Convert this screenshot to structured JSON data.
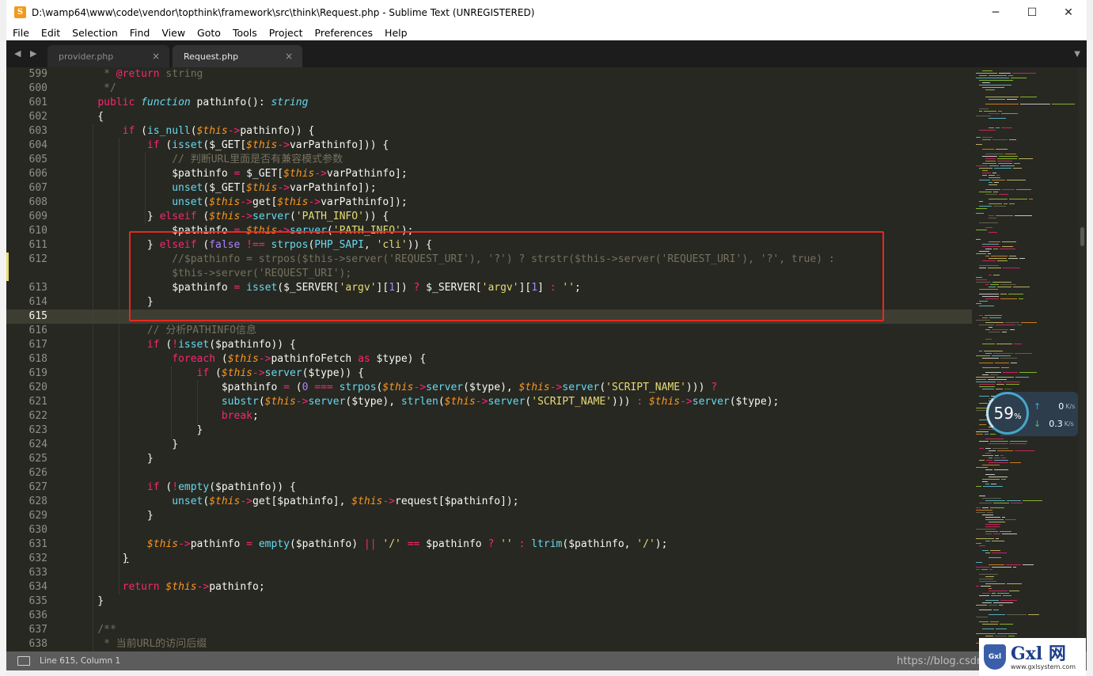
{
  "window": {
    "title": "D:\\wamp64\\www\\code\\vendor\\topthink\\framework\\src\\think\\Request.php - Sublime Text (UNREGISTERED)",
    "app_icon_letter": "S",
    "minimize": "─",
    "maximize": "☐",
    "close": "✕"
  },
  "menu": [
    "File",
    "Edit",
    "Selection",
    "Find",
    "View",
    "Goto",
    "Tools",
    "Project",
    "Preferences",
    "Help"
  ],
  "tabs": [
    {
      "label": "provider.php",
      "active": false,
      "close": "×"
    },
    {
      "label": "Request.php",
      "active": true,
      "close": "×"
    }
  ],
  "tab_nav": "◀ ▶",
  "tab_dropdown": "▼",
  "editor": {
    "current_line": 615,
    "line_numbers": [
      "599",
      "600",
      "601",
      "602",
      "603",
      "604",
      "605",
      "606",
      "607",
      "608",
      "609",
      "610",
      "611",
      "612",
      "",
      "613",
      "614",
      "615",
      "616",
      "617",
      "618",
      "619",
      "620",
      "621",
      "622",
      "623",
      "624",
      "625",
      "626",
      "627",
      "628",
      "629",
      "630",
      "631",
      "632",
      "633",
      "634",
      "635",
      "636",
      "637",
      "638"
    ]
  },
  "status": {
    "position": "Line 615, Column 1"
  },
  "watermark": "https://blog.csdn...",
  "network_widget": {
    "percent": "59",
    "percent_sign": "%",
    "upload": "0",
    "upload_unit": "K/s",
    "download": "0.3",
    "download_unit": "K/s"
  },
  "logo": {
    "badge": "Gxl",
    "main": "Gxl 网",
    "sub": "www.gxlsystem.com"
  },
  "colors": {
    "background": "#272822",
    "keyword": "#f92672",
    "function": "#66d9ef",
    "variable": "#fd971f",
    "string": "#e6db74",
    "number": "#ae81ff",
    "comment": "#75715e",
    "highlight_box": "#e8281f"
  }
}
